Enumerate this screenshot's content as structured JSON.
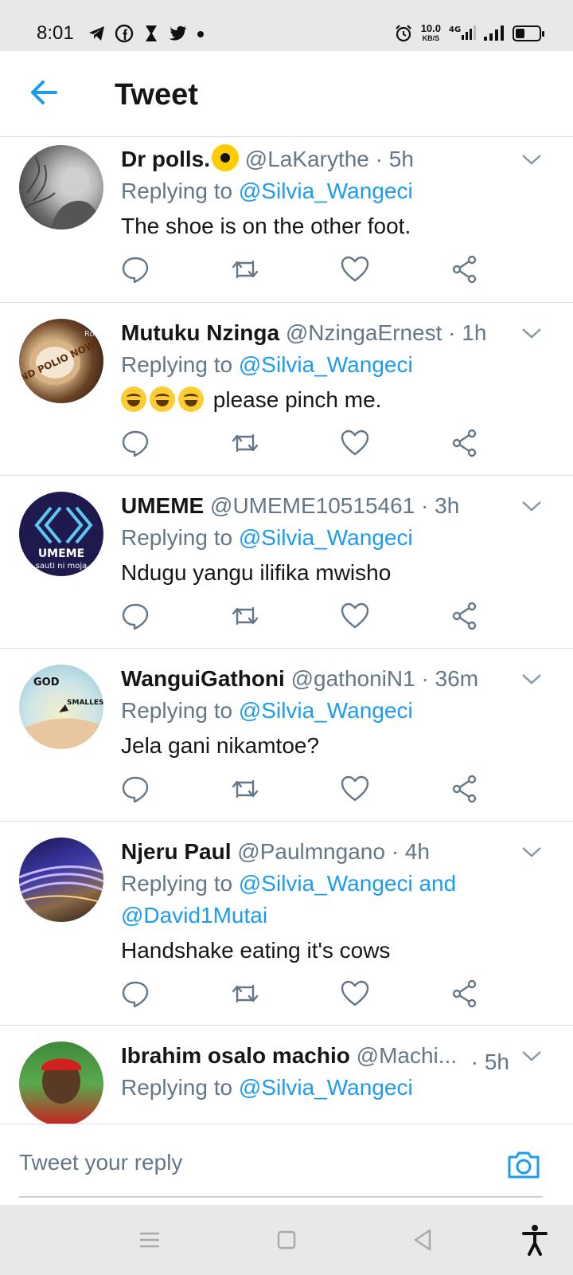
{
  "status_bar": {
    "time": "8:01",
    "left_icons": [
      "telegram-icon",
      "facebook-icon",
      "hourglass-icon",
      "twitter-icon",
      "dot-icon"
    ],
    "net_speed_value": "10.0",
    "net_speed_unit": "KB/S",
    "network": "4G",
    "battery_level": 0.35
  },
  "header": {
    "title": "Tweet"
  },
  "tweets": [
    {
      "name": "Dr polls.",
      "handle": "@LaKarythe",
      "time": "· 5h",
      "replying_prefix": "Replying to ",
      "mention": "@Silvia_Wangeci",
      "text": "The shoe is on the other foot."
    },
    {
      "name": "Mutuku Nzinga",
      "handle": "@NzingaErnest",
      "time": "· 1h",
      "replying_prefix": "Replying to ",
      "mention": "@Silvia_Wangeci",
      "text": "please pinch me."
    },
    {
      "name": "UMEME",
      "handle": "@UMEME10515461",
      "time": "· 3h",
      "replying_prefix": "Replying to ",
      "mention": "@Silvia_Wangeci",
      "text": "Ndugu yangu ilifika mwisho",
      "avatar_text_1": "UMEME",
      "avatar_text_2": "sauti ni moja"
    },
    {
      "name": "WanguiGathoni",
      "handle": "@gathoniN1",
      "time": "· 36m",
      "replying_prefix": "Replying to ",
      "mention": "@Silvia_Wangeci",
      "text": "Jela gani nikamtoe?",
      "avatar_text_1": "GOD",
      "avatar_text_2": "SMALLEST"
    },
    {
      "name": "Njeru Paul",
      "handle": "@Paulmngano",
      "time": "· 4h",
      "replying_prefix": "Replying to ",
      "mention": "@Silvia_Wangeci and",
      "mention2": "@David1Mutai",
      "text": "Handshake eating it's cows"
    },
    {
      "name": "Ibrahim osalo machio",
      "handle": "@Machi...",
      "time": "· 5h",
      "replying_prefix": "Replying to ",
      "mention": "@Silvia_Wangeci"
    }
  ],
  "avatar_2_text": "END POLIO NOW",
  "reply_bar": {
    "placeholder": "Tweet your reply"
  },
  "colors": {
    "accent": "#1d9bf0",
    "secondary_text": "#657786",
    "primary_text": "#14171a"
  }
}
